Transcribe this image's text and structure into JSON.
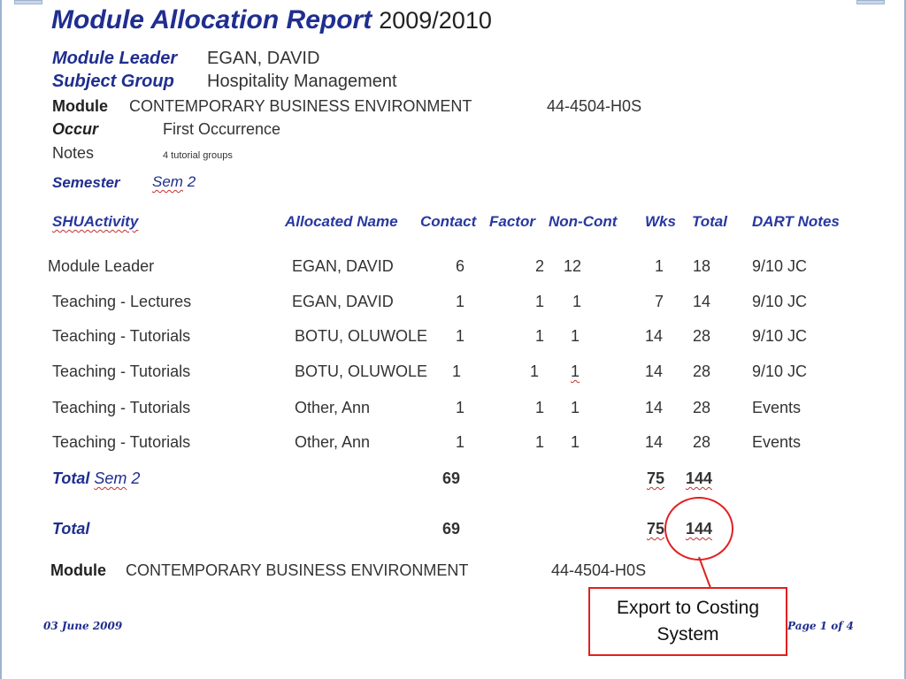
{
  "report": {
    "title": "Module Allocation Report",
    "year": "2009/2010",
    "module_leader_label": "Module Leader",
    "module_leader": "EGAN, DAVID",
    "subject_group_label": "Subject Group",
    "subject_group": "Hospitality Management",
    "module_label": "Module",
    "module_name": "CONTEMPORARY BUSINESS ENVIRONMENT",
    "module_code": "44-4504-H0S",
    "occur_label": "Occur",
    "occur": "First Occurrence",
    "notes_label": "Notes",
    "notes": "4 tutorial groups",
    "semester_label": "Semester",
    "semester_sem": "Sem",
    "semester_num": "2"
  },
  "table": {
    "headers": {
      "activity": "SHUActivity",
      "allocated_name": "Allocated Name",
      "contact": "Contact",
      "factor": "Factor",
      "non_cont": "Non-Cont",
      "wks": "Wks",
      "total": "Total",
      "dart_notes": "DART Notes"
    },
    "rows": [
      {
        "activity": "Module Leader",
        "name": "EGAN, DAVID",
        "contact": "6",
        "factor": "2",
        "non_cont": "12",
        "wks": "1",
        "total": "18",
        "notes": "9/10 JC"
      },
      {
        "activity": "Teaching - Lectures",
        "name": "EGAN, DAVID",
        "contact": "1",
        "factor": "1",
        "non_cont": "1",
        "wks": "7",
        "total": "14",
        "notes": "9/10 JC"
      },
      {
        "activity": "Teaching - Tutorials",
        "name": "BOTU, OLUWOLE",
        "contact": "1",
        "factor": "1",
        "non_cont": "1",
        "wks": "14",
        "total": "28",
        "notes": "9/10 JC"
      },
      {
        "activity": "Teaching - Tutorials",
        "name": "BOTU, OLUWOLE",
        "contact": "1",
        "factor": "1",
        "non_cont": "1",
        "wks": "14",
        "total": "28",
        "notes": "9/10 JC"
      },
      {
        "activity": "Teaching - Tutorials",
        "name": "Other, Ann",
        "contact": "1",
        "factor": "1",
        "non_cont": "1",
        "wks": "14",
        "total": "28",
        "notes": "Events"
      },
      {
        "activity": "Teaching - Tutorials",
        "name": "Other, Ann",
        "contact": "1",
        "factor": "1",
        "non_cont": "1",
        "wks": "14",
        "total": "28",
        "notes": "Events"
      }
    ],
    "sem_total": {
      "label": "Total",
      "sem": "Sem",
      "num": "2",
      "contact": "69",
      "wks": "75",
      "total": "144"
    },
    "grand_total": {
      "label": "Total",
      "contact": "69",
      "wks": "75",
      "total": "144"
    }
  },
  "footer": {
    "module_label": "Module",
    "module_name": "CONTEMPORARY BUSINESS ENVIRONMENT",
    "module_code": "44-4504-H0S",
    "date": "03 June 2009",
    "page": "Page 1 of 4"
  },
  "callout": {
    "text": "Export to Costing System",
    "color": "#e02020"
  }
}
